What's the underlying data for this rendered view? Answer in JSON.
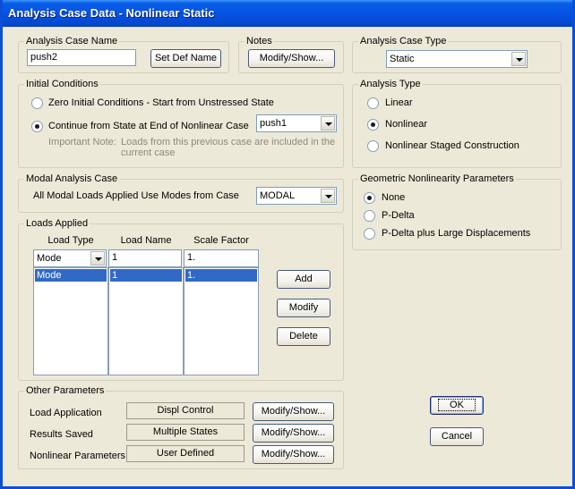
{
  "window": {
    "title": "Analysis Case Data - Nonlinear Static"
  },
  "case_name": {
    "label": "Analysis Case Name",
    "value": "push2",
    "set_def_button": "Set Def Name"
  },
  "notes": {
    "label": "Notes",
    "button": "Modify/Show..."
  },
  "case_type": {
    "label": "Analysis Case Type",
    "value": "Static"
  },
  "initial_conditions": {
    "label": "Initial Conditions",
    "option_zero": "Zero Initial Conditions - Start from Unstressed State",
    "option_continue": "Continue from State at End of Nonlinear Case",
    "selected": "continue",
    "case_value": "push1",
    "note_label": "Important Note:",
    "note_line1": "Loads from this previous case are included in the",
    "note_line2": "current case"
  },
  "modal": {
    "label": "Modal Analysis Case",
    "text": "All Modal Loads Applied Use Modes from Case",
    "value": "MODAL"
  },
  "loads": {
    "label": "Loads Applied",
    "headers": {
      "load_type": "Load Type",
      "load_name": "Load Name",
      "scale_factor": "Scale Factor"
    },
    "input": {
      "load_type": "Mode",
      "load_name": "1",
      "scale_factor": "1."
    },
    "rows": [
      {
        "load_type": "Mode",
        "load_name": "1",
        "scale_factor": "1."
      }
    ],
    "add_button": "Add",
    "modify_button": "Modify",
    "delete_button": "Delete"
  },
  "other": {
    "label": "Other Parameters",
    "load_application": {
      "label": "Load Application",
      "value": "Displ Control",
      "button": "Modify/Show..."
    },
    "results_saved": {
      "label": "Results Saved",
      "value": "Multiple States",
      "button": "Modify/Show..."
    },
    "nonlinear_params": {
      "label": "Nonlinear Parameters",
      "value": "User Defined",
      "button": "Modify/Show..."
    }
  },
  "analysis_type": {
    "label": "Analysis Type",
    "linear": "Linear",
    "nonlinear": "Nonlinear",
    "staged": "Nonlinear Staged Construction",
    "selected": "nonlinear"
  },
  "geometric": {
    "label": "Geometric Nonlinearity Parameters",
    "none": "None",
    "pdelta": "P-Delta",
    "pdelta_large": "P-Delta plus Large Displacements",
    "selected": "none"
  },
  "ok_button": "OK",
  "cancel_button": "Cancel",
  "colors": {
    "title_bar": "#0553e2",
    "selection": "#316ac5",
    "dialog_bg": "#ece9d8"
  }
}
